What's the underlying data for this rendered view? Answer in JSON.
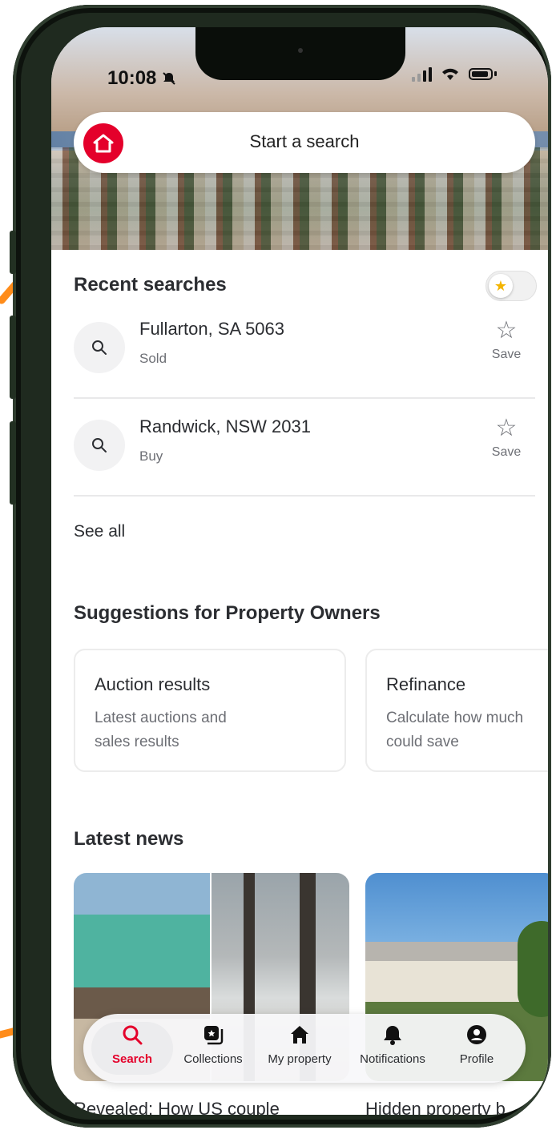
{
  "status": {
    "time": "10:08"
  },
  "search": {
    "placeholder": "Start a search"
  },
  "recent": {
    "title": "Recent searches",
    "items": [
      {
        "title": "Fullarton, SA 5063",
        "sub": "Sold",
        "save": "Save"
      },
      {
        "title": "Randwick, NSW 2031",
        "sub": "Buy",
        "save": "Save"
      }
    ],
    "see_all": "See all"
  },
  "suggestions": {
    "title": "Suggestions for Property Owners",
    "cards": [
      {
        "title": "Auction results",
        "desc": "Latest auctions and\nsales results"
      },
      {
        "title": "Refinance",
        "desc": "Calculate how much\ncould save"
      }
    ]
  },
  "news": {
    "title": "Latest news",
    "items": [
      {
        "title": "Revealed: How US couple"
      },
      {
        "title": "Hidden property b"
      }
    ]
  },
  "tabs": [
    {
      "label": "Search",
      "icon": "search-icon"
    },
    {
      "label": "Collections",
      "icon": "collections-icon"
    },
    {
      "label": "My property",
      "icon": "home-icon"
    },
    {
      "label": "Notifications",
      "icon": "bell-icon"
    },
    {
      "label": "Profile",
      "icon": "profile-icon"
    }
  ],
  "colors": {
    "brand": "#e4002b",
    "annotation_arrow": "#ff8c1a",
    "text": "#2b2d31"
  }
}
